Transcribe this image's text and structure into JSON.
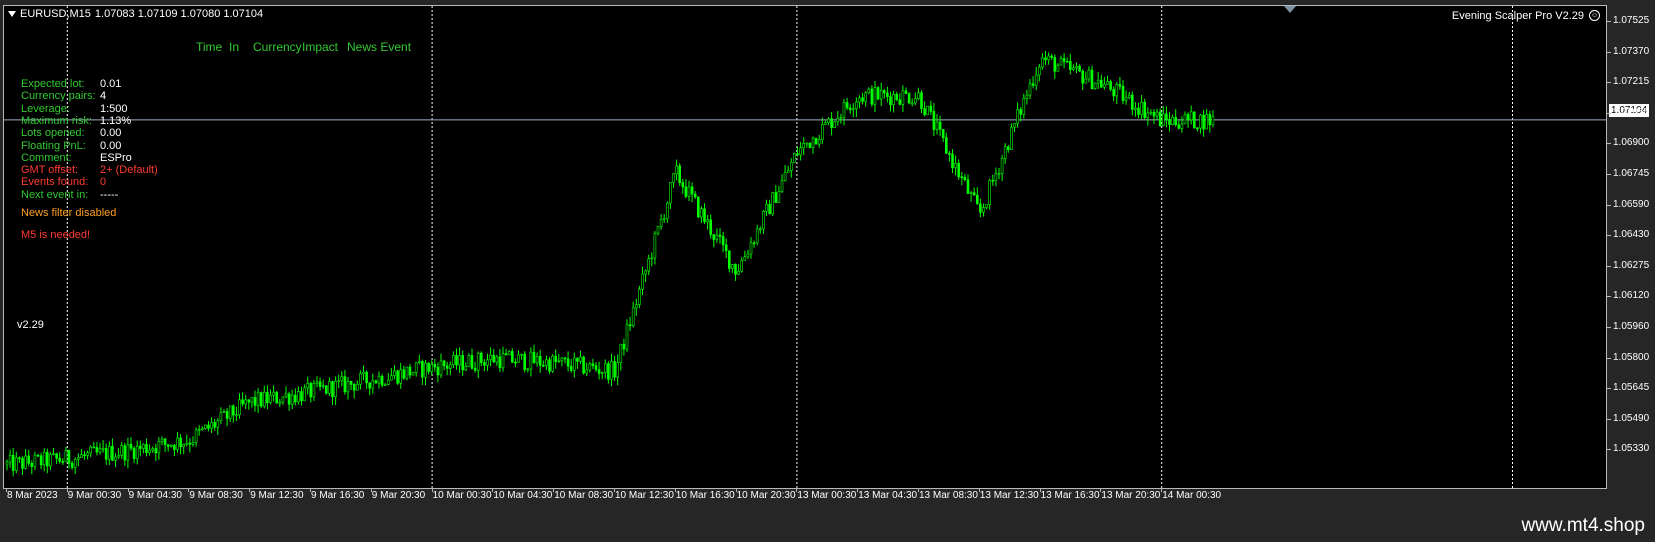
{
  "colors": {
    "background": "#000000",
    "frame": "#b8b8b8",
    "candle": "#00ff00",
    "grid_vline": "#ffffff",
    "price_line": "#9fb0c2",
    "text_green": "#31c931",
    "text_red": "#ff3b30",
    "text_orange": "#ff9e1f",
    "text_white": "#ffffff"
  },
  "header": {
    "symbol": "EURUSD,M15",
    "ohlc": "1.07083 1.07109 1.07080 1.07104",
    "ea_name": "Evening Scalper Pro V2.29",
    "ea_icon": "smile-icon",
    "menu_icon": "triangle-down-icon"
  },
  "news_table": {
    "headers": [
      "Time",
      "In",
      "Currency",
      "Impact",
      "News Event"
    ]
  },
  "info_panel": [
    {
      "label": "Expected lot:",
      "value": "0.01",
      "color": "#31c931",
      "value_color": "#ffffff"
    },
    {
      "label": "Currency pairs:",
      "value": "4",
      "color": "#31c931",
      "value_color": "#ffffff"
    },
    {
      "label": "Leverage:",
      "value": "1:500",
      "color": "#31c931",
      "value_color": "#ffffff"
    },
    {
      "label": "Maximum risk:",
      "value": "1.13%",
      "color": "#31c931",
      "value_color": "#ffffff"
    },
    {
      "label": "Lots opened:",
      "value": "0.00",
      "color": "#31c931",
      "value_color": "#ffffff"
    },
    {
      "label": "Floating PnL:",
      "value": "0.00",
      "color": "#31c931",
      "value_color": "#ffffff"
    },
    {
      "label": "Comment:",
      "value": "ESPro",
      "color": "#31c931",
      "value_color": "#ffffff"
    },
    {
      "label": "GMT offset:",
      "value": "2+ (Default)",
      "color": "#ff3b30",
      "value_color": "#ff3b30"
    },
    {
      "label": "Events found:",
      "value": "0",
      "color": "#ff3b30",
      "value_color": "#ff3b30"
    },
    {
      "label": "Next event in:",
      "value": "-----",
      "color": "#31c931",
      "value_color": "#ffffff"
    }
  ],
  "messages": {
    "news_filter": "News filter disabled",
    "timeframe_warning": "M5 is needed!",
    "version": "v2.29"
  },
  "price_axis": {
    "labels": [
      "1.07525",
      "1.07370",
      "1.07215",
      "1.07055",
      "1.06900",
      "1.06745",
      "1.06590",
      "1.06430",
      "1.06275",
      "1.06120",
      "1.05960",
      "1.05800",
      "1.05645",
      "1.05490",
      "1.05330"
    ],
    "current_price": "1.07104"
  },
  "time_axis": {
    "labels": [
      "8 Mar 2023",
      "9 Mar 00:30",
      "9 Mar 04:30",
      "9 Mar 08:30",
      "9 Mar 12:30",
      "9 Mar 16:30",
      "9 Mar 20:30",
      "10 Mar 00:30",
      "10 Mar 04:30",
      "10 Mar 08:30",
      "10 Mar 12:30",
      "10 Mar 16:30",
      "10 Mar 20:30",
      "13 Mar 00:30",
      "13 Mar 04:30",
      "13 Mar 08:30",
      "13 Mar 12:30",
      "13 Mar 16:30",
      "13 Mar 20:30",
      "14 Mar 00:30"
    ]
  },
  "chart_data": {
    "type": "candlestick",
    "symbol": "EURUSD",
    "timeframe": "M15",
    "ylim": [
      1.0533,
      1.0765
    ],
    "current_price": 1.07104,
    "series_path": [
      {
        "t": "8 Mar 2023",
        "price": 1.0545
      },
      {
        "t": "9 Mar 00:30",
        "price": 1.0548
      },
      {
        "t": "9 Mar 04:30",
        "price": 1.0552
      },
      {
        "t": "9 Mar 08:30",
        "price": 1.0557
      },
      {
        "t": "9 Mar 12:30",
        "price": 1.0575
      },
      {
        "t": "9 Mar 16:30",
        "price": 1.058
      },
      {
        "t": "9 Mar 20:30",
        "price": 1.0586
      },
      {
        "t": "10 Mar 00:30",
        "price": 1.0592
      },
      {
        "t": "10 Mar 04:30",
        "price": 1.0596
      },
      {
        "t": "10 Mar 08:30",
        "price": 1.0594
      },
      {
        "t": "10 Mar 12:30",
        "price": 1.059
      },
      {
        "t": "10 Mar 16:30",
        "price": 1.0685
      },
      {
        "t": "10 Mar 20:30",
        "price": 1.0638
      },
      {
        "t": "13 Mar 00:30",
        "price": 1.0695
      },
      {
        "t": "13 Mar 04:30",
        "price": 1.0722
      },
      {
        "t": "13 Mar 08:30",
        "price": 1.0722
      },
      {
        "t": "13 Mar 12:30",
        "price": 1.0665
      },
      {
        "t": "13 Mar 16:30",
        "price": 1.074
      },
      {
        "t": "13 Mar 20:30",
        "price": 1.0728
      },
      {
        "t": "14 Mar 00:30",
        "price": 1.071
      }
    ],
    "period_separators": [
      "9 Mar 00:30",
      "10 Mar 00:30",
      "13 Mar 00:30",
      "14 Mar 00:30"
    ]
  }
}
